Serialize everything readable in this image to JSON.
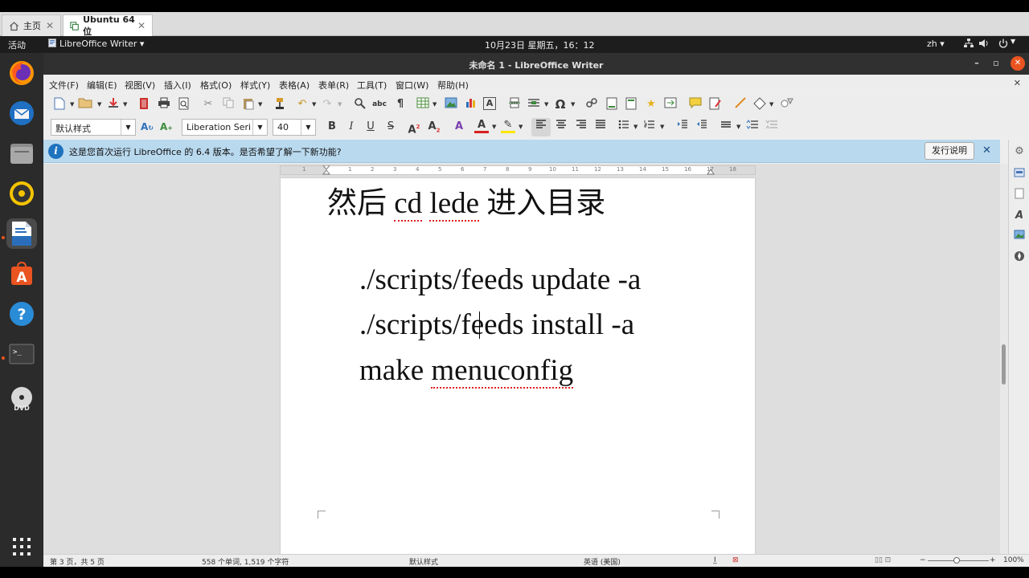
{
  "host_tabs": [
    {
      "label": "主页"
    },
    {
      "label": "Ubuntu 64 位"
    }
  ],
  "topbar": {
    "activities": "活动",
    "app_menu": "LibreOffice Writer ▾",
    "clock": "10月23日 星期五，16：12",
    "input_method": "zh ▾"
  },
  "dock": {
    "items": [
      "firefox-icon",
      "thunderbird-icon",
      "files-icon",
      "rhythmbox-icon",
      "writer-icon",
      "software-center-icon",
      "help-icon",
      "terminal-icon",
      "dvd-icon",
      "show-apps-icon"
    ]
  },
  "window": {
    "title": "未命名 1 - LibreOffice Writer"
  },
  "menubar": {
    "items": [
      "文件(F)",
      "编辑(E)",
      "视图(V)",
      "插入(I)",
      "格式(O)",
      "样式(Y)",
      "表格(A)",
      "表单(R)",
      "工具(T)",
      "窗口(W)",
      "帮助(H)"
    ]
  },
  "formatting": {
    "paragraph_style": "默认样式",
    "font_name": "Liberation Seri",
    "font_size": "40"
  },
  "infobar": {
    "message": "这是您首次运行 LibreOffice 的 6.4 版本。是否希望了解一下新功能?",
    "button_label": "发行说明",
    "close_symbol": "✕"
  },
  "ruler": {
    "marks": [
      "1",
      "1",
      "2",
      "3",
      "4",
      "5",
      "6",
      "7",
      "8",
      "9",
      "10",
      "11",
      "12",
      "13",
      "14",
      "15",
      "16",
      "17",
      "18"
    ]
  },
  "document": {
    "lines": [
      {
        "pre": "然后 ",
        "w1": "cd",
        "mid": " ",
        "w2": "lede",
        "post": " 进入目录"
      },
      {
        "text": "./scripts/feeds update -a"
      },
      {
        "text": "./scripts/feeds install -a"
      },
      {
        "pre": "make ",
        "w1": "menuconfig"
      }
    ]
  },
  "statusbar": {
    "page": "第 3 页，共 5 页",
    "word_count": "558 个单词, 1,519 个字符",
    "page_style": "默认样式",
    "language": "英语 (美国)",
    "zoom": "100%"
  },
  "colors": {
    "accent": "#e95420",
    "infobar": "#b9d9ee",
    "dock": "#2b2b2b"
  }
}
